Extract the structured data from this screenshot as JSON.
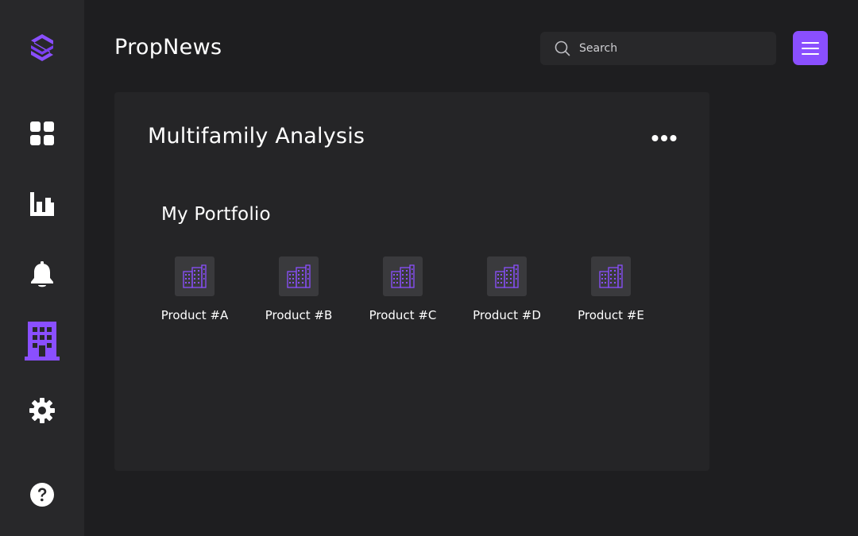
{
  "app": {
    "title": "PropNews",
    "accent_color": "#8a4fff"
  },
  "sidebar": {
    "items": [
      {
        "name": "logo",
        "icon": "brand-logo-icon"
      },
      {
        "name": "dashboard",
        "icon": "grid-icon"
      },
      {
        "name": "analytics",
        "icon": "bar-chart-icon"
      },
      {
        "name": "notifications",
        "icon": "bell-icon"
      },
      {
        "name": "properties",
        "icon": "building-icon",
        "active": true
      },
      {
        "name": "settings",
        "icon": "gear-icon"
      },
      {
        "name": "help",
        "icon": "help-icon"
      }
    ]
  },
  "header": {
    "search_placeholder": "Search",
    "search_icon": "search-icon",
    "menu_icon": "hamburger-menu-icon"
  },
  "card": {
    "title": "Multifamily Analysis",
    "more_icon": "more-dots-icon",
    "section_title": "My Portfolio",
    "products": [
      {
        "label": "Product #A",
        "icon": "building-icon"
      },
      {
        "label": "Product #B",
        "icon": "building-icon"
      },
      {
        "label": "Product #C",
        "icon": "building-icon"
      },
      {
        "label": "Product #D",
        "icon": "building-icon"
      },
      {
        "label": "Product #E",
        "icon": "building-icon"
      }
    ]
  }
}
